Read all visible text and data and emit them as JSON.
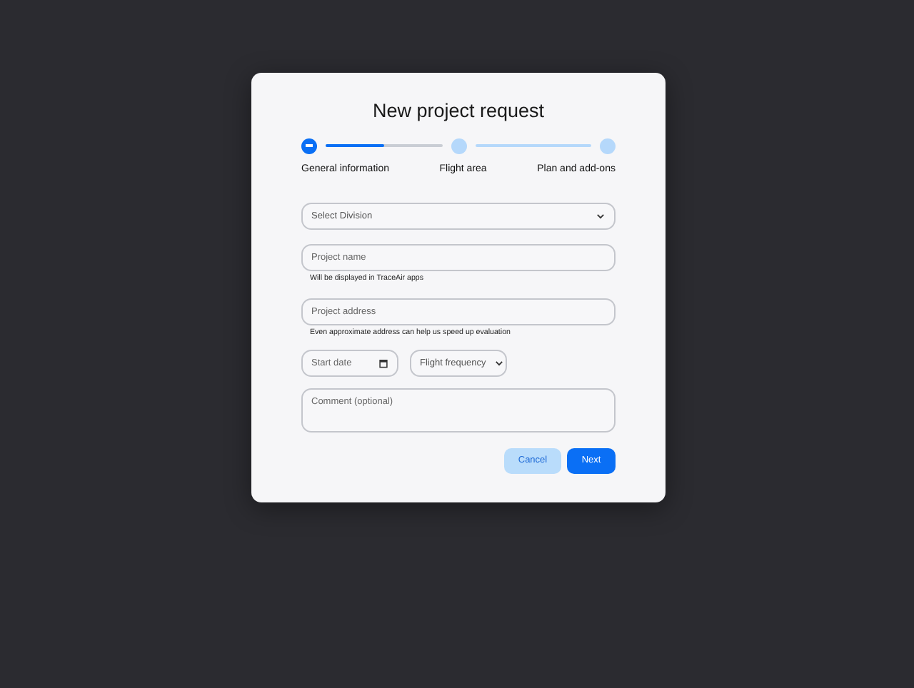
{
  "dialog": {
    "title": "New project request"
  },
  "steps": [
    {
      "label": "General information",
      "selected": true,
      "level": 0.5
    },
    {
      "label": "Flight area",
      "selected": false
    },
    {
      "label": "Plan and add-ons",
      "selected": false
    }
  ],
  "fields": [
    {
      "kind": "select",
      "placeholder": "Select Division"
    },
    {
      "kind": "text",
      "placeholder": "Project name",
      "helper": "Will be displayed in TraceAir apps"
    },
    {
      "kind": "text",
      "placeholder": "Project address",
      "helper": "Even approximate address can help us speed up evaluation"
    }
  ],
  "inline_fields": [
    {
      "kind": "date",
      "placeholder": "Start date"
    },
    {
      "kind": "select",
      "placeholder": "Flight frequency"
    }
  ],
  "comment": {
    "placeholder": "Comment (optional)"
  },
  "buttons": [
    {
      "label": "Cancel",
      "kind": "secondary"
    },
    {
      "label": "Next",
      "kind": "primary"
    }
  ]
}
